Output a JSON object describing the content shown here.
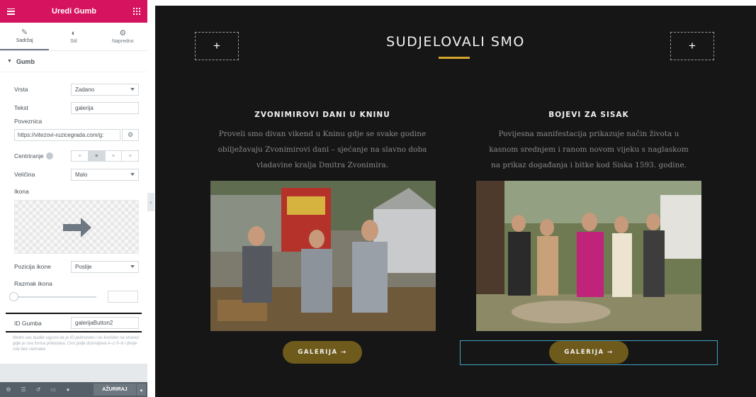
{
  "editor": {
    "title": "Uredi Gumb",
    "tabs": [
      {
        "label": "Sadržaj",
        "icon": "pencil-icon",
        "active": true
      },
      {
        "label": "Stil",
        "icon": "contrast-icon",
        "active": false
      },
      {
        "label": "Napredno",
        "icon": "gear-icon",
        "active": false
      }
    ],
    "section": "Gumb",
    "fields": {
      "vrsta": {
        "label": "Vrsta",
        "value": "Zadano"
      },
      "tekst": {
        "label": "Tekst",
        "value": "galerija"
      },
      "poveznica": {
        "label": "Poveznica",
        "value": "https://vitezovi-ruzicegrada.com/g:"
      },
      "centriranje": {
        "label": "Centriranje"
      },
      "velicina": {
        "label": "Veličina",
        "value": "Malo"
      },
      "ikona": {
        "label": "Ikona"
      },
      "pozicija_ikone": {
        "label": "Pozicija ikone",
        "value": "Poslije"
      },
      "razmak_ikona": {
        "label": "Razmak ikona"
      },
      "id_gumba": {
        "label": "ID Gumba",
        "value": "galerijaButton2"
      }
    },
    "note": "Molim vas budite sigurni da je ID jedinstven i ne korišten na stranici gdje je ova forma prikazana. Ovo polje dozvoljava A–z 0–9 i donje crte bez razmaka",
    "footer": {
      "update_label": "AŽURIRAJ"
    }
  },
  "page": {
    "heading": "SUDJELOVALI SMO",
    "accent_color": "#d4a62a",
    "button_color": "#6e5a1b",
    "columns": [
      {
        "title": "ZVONIMIROVI DANI U KNINU",
        "lines": [
          "Proveli smo divan vikend u Kninu gdje se svake godine",
          "obilježavaju Zvonimirovi dani – sjećanje na slavno doba",
          "vladavine kralja Dmitra Zvonimira."
        ],
        "button": "GALERIJA →"
      },
      {
        "title": "BOJEVI ZA SISAK",
        "lines": [
          "Povijesna manifestacija prikazuje način života u",
          "kasnom srednjem i ranom novom vijeku s naglaskom",
          "na prikaz događanja i bitke kod Siska 1593. godine."
        ],
        "button": "GALERIJA →"
      }
    ]
  }
}
